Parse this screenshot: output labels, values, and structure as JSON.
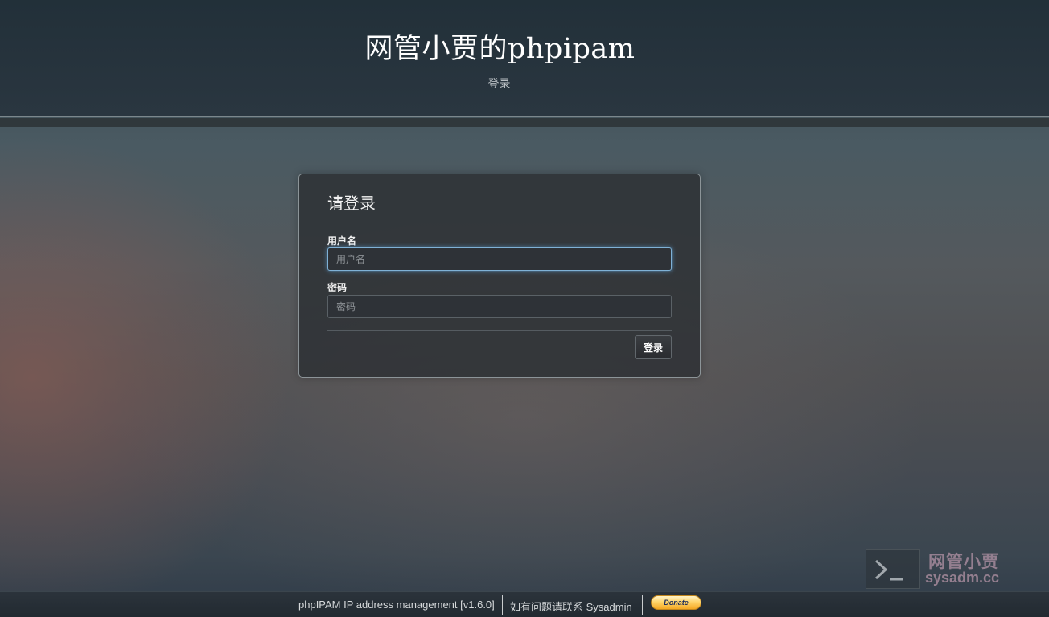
{
  "header": {
    "title": "网管小贾的phpipam",
    "subtitle": "登录"
  },
  "login": {
    "heading": "请登录",
    "username_label": "用户名",
    "username_placeholder": "用户名",
    "username_value": "",
    "password_label": "密码",
    "password_placeholder": "密码",
    "password_value": "",
    "submit_label": "登录"
  },
  "footer": {
    "version_text": "phpIPAM IP address management [v1.6.0]",
    "contact_text": "如有问题请联系 Sysadmin",
    "donate_label": "Donate"
  },
  "watermark": {
    "icon": "terminal-icon",
    "line1": "网管小贾",
    "line2": "sysadm.cc"
  },
  "colors": {
    "header_bg": "#223039",
    "focus_glow": "#66afe9",
    "donate_gold": "#ffd56b"
  }
}
